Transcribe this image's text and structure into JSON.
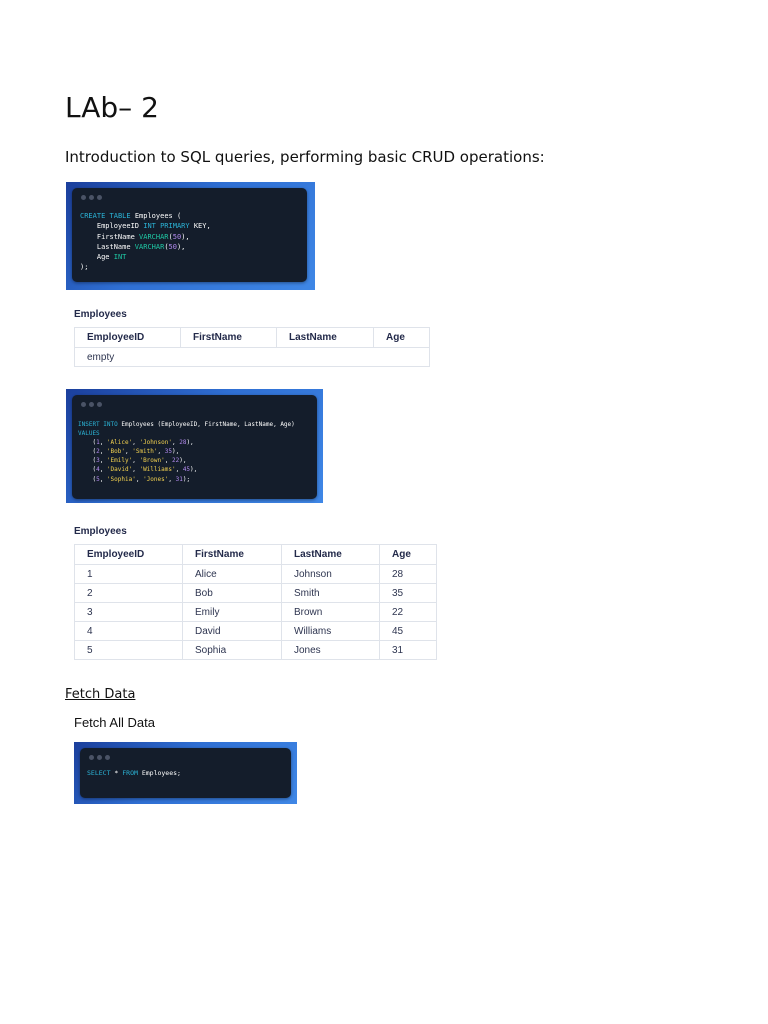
{
  "document": {
    "title": "LAb– 2",
    "intro": "Introduction to SQL queries, performing basic CRUD operations:"
  },
  "code_blocks": {
    "create": {
      "k1": "CREATE",
      "k2": "TABLE",
      "t1": "Employees (",
      "l2a": "EmployeeID",
      "l2b": "INT PRIMARY",
      "l2c": "KEY,",
      "l3a": "FirstName",
      "l3b": "VARCHAR",
      "l3n": "50",
      "l4a": "LastName",
      "l4b": "VARCHAR",
      "l4n": "50",
      "l5a": "Age",
      "l5b": "INT",
      "close": ");"
    },
    "insert": {
      "k1": "INSERT INTO",
      "t1": "Employees (EmployeeID, FirstName, LastName, Age)",
      "k2": "VALUES",
      "rows": [
        {
          "id": "1",
          "first": "'Alice'",
          "last": "'Johnson'",
          "age": "28",
          "end": "),"
        },
        {
          "id": "2",
          "first": "'Bob'",
          "last": "'Smith'",
          "age": "35",
          "end": "),"
        },
        {
          "id": "3",
          "first": "'Emily'",
          "last": "'Brown'",
          "age": "22",
          "end": "),"
        },
        {
          "id": "4",
          "first": "'David'",
          "last": "'Williams'",
          "age": "45",
          "end": "),"
        },
        {
          "id": "5",
          "first": "'Sophia'",
          "last": "'Jones'",
          "age": "31",
          "end": ");"
        }
      ]
    },
    "select": {
      "k1": "SELECT",
      "star": "*",
      "k2": "FROM",
      "t1": "Employees;"
    }
  },
  "table_empty": {
    "caption": "Employees",
    "headers": [
      "EmployeeID",
      "FirstName",
      "LastName",
      "Age"
    ],
    "empty_text": "empty"
  },
  "table_filled": {
    "caption": "Employees",
    "headers": [
      "EmployeeID",
      "FirstName",
      "LastName",
      "Age"
    ],
    "rows": [
      [
        "1",
        "Alice",
        "Johnson",
        "28"
      ],
      [
        "2",
        "Bob",
        "Smith",
        "35"
      ],
      [
        "3",
        "Emily",
        "Brown",
        "22"
      ],
      [
        "4",
        "David",
        "Williams",
        "45"
      ],
      [
        "5",
        "Sophia",
        "Jones",
        "31"
      ]
    ]
  },
  "fetch": {
    "heading": "Fetch Data",
    "subheading": "Fetch All Data"
  },
  "colors": {
    "keyword": "#2bb3d6",
    "type": "#1fc9a5",
    "number": "#b48cf0",
    "string": "#f2d14f",
    "editor_bg": "#141d2b",
    "frame_blue": "#2f6fd3"
  }
}
